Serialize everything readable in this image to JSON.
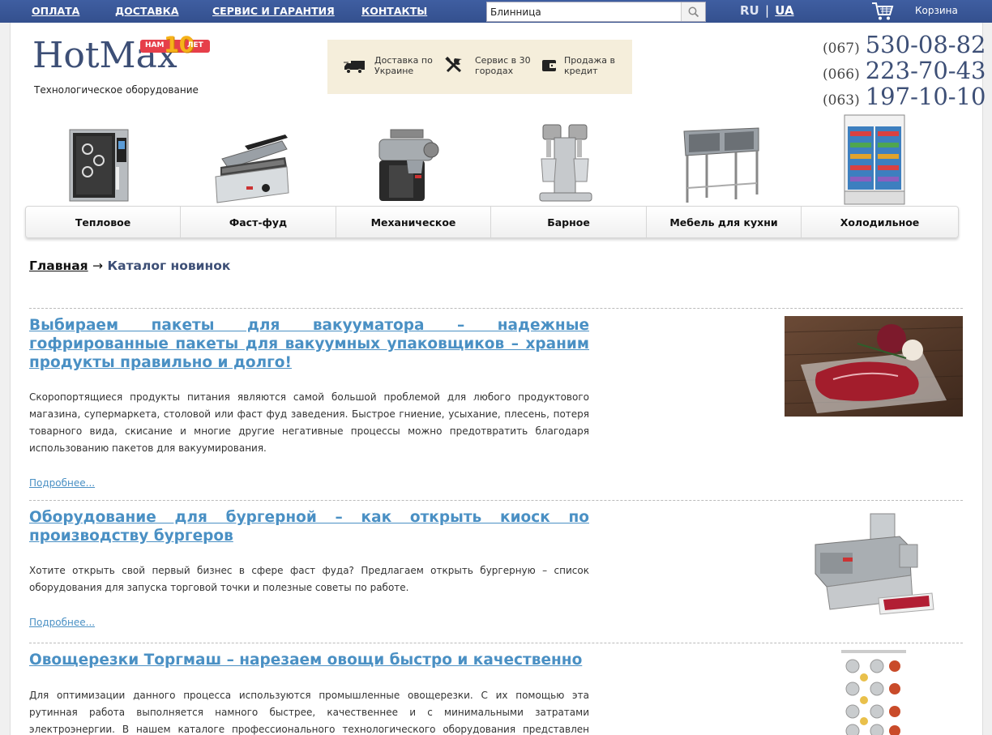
{
  "topnav": {
    "items": [
      {
        "label": "ОПЛАТА"
      },
      {
        "label": "ДОСТАВКА"
      },
      {
        "label": "СЕРВИС И ГАРАНТИЯ"
      },
      {
        "label": "КОНТАКТЫ"
      }
    ],
    "search_value": "Блинница",
    "lang_ru": "RU",
    "lang_sep": "|",
    "lang_ua": "UA",
    "cart_label": "Корзина"
  },
  "header": {
    "logo": "HotMax",
    "badge_left": "НАМ",
    "badge_num": "10",
    "badge_right": "ЛЕТ",
    "tagline": "Технологическое оборудование",
    "info": [
      {
        "icon": "truck-icon",
        "line1": "Доставка по",
        "line2": "Украине"
      },
      {
        "icon": "tools-icon",
        "line1": "Сервис в 30",
        "line2": "городах"
      },
      {
        "icon": "wallet-icon",
        "line1": "Продажа в",
        "line2": "кредит"
      }
    ],
    "phones": [
      {
        "code": "(067)",
        "number": "530-08-82"
      },
      {
        "code": "(066)",
        "number": "223-70-43"
      },
      {
        "code": "(063)",
        "number": "197-10-10"
      }
    ]
  },
  "categories": [
    {
      "label": "Тепловое",
      "icon": "combi-oven-image"
    },
    {
      "label": "Фаст-фуд",
      "icon": "contact-grill-image"
    },
    {
      "label": "Механическое",
      "icon": "meat-grinder-image"
    },
    {
      "label": "Барное",
      "icon": "milkshake-mixer-image"
    },
    {
      "label": "Мебель для кухни",
      "icon": "steel-sink-table-image"
    },
    {
      "label": "Холодильное",
      "icon": "display-fridge-image"
    }
  ],
  "breadcrumb": {
    "home": "Главная",
    "arrow": "→",
    "current": "Каталог новинок"
  },
  "articles": [
    {
      "title": "Выбираем пакеты для вакууматора – надежные гофрированные пакеты для вакуумных упаковщиков – храним продукты правильно и долго!",
      "text": "Скоропортящиеся продукты питания являются самой большой проблемой для любого продуктового магазина, супермаркета, столовой или фаст фуд заведения. Быстрое гниение, усыхание, плесень, потеря товарного вида, скисание и многие другие негативные процессы можно предотвратить благодаря использованию пакетов для вакуумирования.",
      "more": "Подробнее..."
    },
    {
      "title": "Оборудование для бургерной – как открыть киоск по производству бургеров",
      "text": "Хотите открыть свой первый бизнес в сфере фаст фуда? Предлагаем открыть бургерную – список оборудования для запуска торговой точки и полезные советы по работе.",
      "more": "Подробнее..."
    },
    {
      "title": "Овощерезки Торгмаш – нарезаем овощи быстро и качественно",
      "text": "Для оптимизации данного процесса используются промышленные овощерезки. С их помощью эта рутинная работа выполняется намного быстрее, качественнее и с минимальными затратами электроэнергии. В нашем каталоге профессионального технологического оборудования представлен широкий ассортимент"
    }
  ]
}
